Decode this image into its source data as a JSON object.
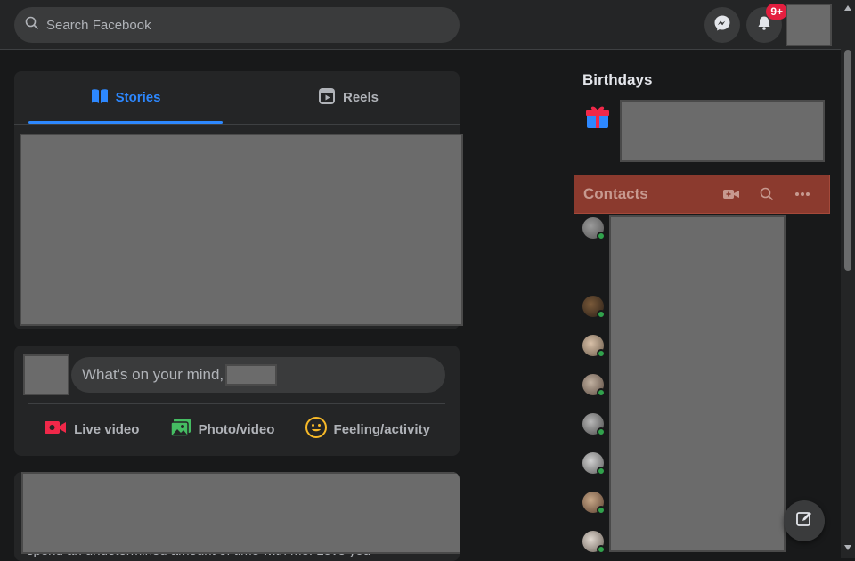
{
  "header": {
    "search_placeholder": "Search Facebook",
    "notifications_badge": "9+"
  },
  "feed": {
    "tabs": [
      {
        "label": "Stories",
        "active": true
      },
      {
        "label": "Reels",
        "active": false
      }
    ],
    "composer": {
      "prompt": "What's on your mind,",
      "actions": [
        {
          "label": "Live video",
          "icon": "live-video-icon"
        },
        {
          "label": "Photo/video",
          "icon": "photo-video-icon"
        },
        {
          "label": "Feeling/activity",
          "icon": "feeling-icon"
        }
      ]
    },
    "post_snippet": "spend an undetermined amount of time with me. Love you"
  },
  "sidebar": {
    "birthdays_title": "Birthdays",
    "contacts_title": "Contacts"
  },
  "colors": {
    "accent": "#2d88ff",
    "online": "#31a24c",
    "badge": "#e41e3f",
    "contacts_highlight": "#8b3a2e"
  }
}
